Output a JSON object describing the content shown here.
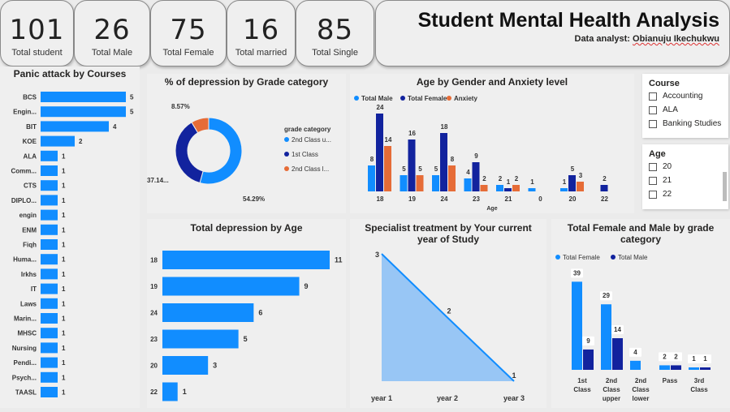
{
  "kpis": [
    {
      "value": "101",
      "label": "Total student"
    },
    {
      "value": "26",
      "label": "Total Male"
    },
    {
      "value": "75",
      "label": "Total Female"
    },
    {
      "value": "16",
      "label": "Total married"
    },
    {
      "value": "85",
      "label": "Total Single"
    }
  ],
  "header": {
    "title": "Student Mental Health Analysis",
    "subtitle_prefix": "Data analyst: ",
    "analyst_name": "Obianuju Ikechukwu"
  },
  "slicers": {
    "course": {
      "title": "Course",
      "items": [
        "Accounting",
        "ALA",
        "Banking Studies"
      ]
    },
    "age": {
      "title": "Age",
      "items": [
        "20",
        "21",
        "22"
      ]
    }
  },
  "colors": {
    "blue": "#118dff",
    "navy": "#12239e",
    "orange": "#e66c37",
    "light_blue": "#98c6f5"
  },
  "chart_data": [
    {
      "id": "panic",
      "type": "bar",
      "orientation": "horizontal",
      "title": "Panic attack by Courses",
      "categories": [
        "BCS",
        "Engin...",
        "BIT",
        "KOE",
        "ALA",
        "Comm...",
        "CTS",
        "DIPLO...",
        "engin",
        "ENM",
        "Fiqh",
        "Huma...",
        "Irkhs",
        "IT",
        "Laws",
        "Marin...",
        "MHSC",
        "Nursing",
        "Pendi...",
        "Psych...",
        "TAASL"
      ],
      "values": [
        5,
        5,
        4,
        2,
        1,
        1,
        1,
        1,
        1,
        1,
        1,
        1,
        1,
        1,
        1,
        1,
        1,
        1,
        1,
        1,
        1
      ],
      "xlim": [
        0,
        5
      ]
    },
    {
      "id": "donut",
      "type": "pie",
      "title": "% of depression by Grade category",
      "legend_title": "grade category",
      "legend": [
        "2nd Class u...",
        "1st Class",
        "2nd Class l..."
      ],
      "values": [
        54.29,
        37.14,
        8.57
      ],
      "labels": [
        "54.29%",
        "37.14...",
        "8.57%"
      ]
    },
    {
      "id": "ageGender",
      "type": "bar",
      "title": "Age by Gender and Anxiety level",
      "xlabel": "Age",
      "categories": [
        "18",
        "19",
        "24",
        "23",
        "21",
        "0",
        "20",
        "22"
      ],
      "series": [
        {
          "name": "Total Male",
          "values": [
            8,
            5,
            5,
            4,
            2,
            1,
            1,
            null
          ]
        },
        {
          "name": "Total Female",
          "values": [
            24,
            16,
            18,
            9,
            1,
            null,
            5,
            2
          ]
        },
        {
          "name": "Anxiety",
          "values": [
            14,
            5,
            8,
            2,
            2,
            null,
            3,
            null
          ]
        }
      ],
      "ylim": [
        0,
        26
      ]
    },
    {
      "id": "depAge",
      "type": "bar",
      "orientation": "horizontal",
      "title": "Total depression by Age",
      "categories": [
        "18",
        "19",
        "24",
        "23",
        "20",
        "22"
      ],
      "values": [
        11,
        9,
        6,
        5,
        3,
        1
      ],
      "xlim": [
        0,
        11
      ]
    },
    {
      "id": "specialist",
      "type": "area",
      "title": "Specialist treatment by Your current year of Study",
      "categories": [
        "year 1",
        "year 2",
        "year 3"
      ],
      "values": [
        3,
        2,
        1
      ],
      "ylim": [
        1,
        3
      ]
    },
    {
      "id": "grade",
      "type": "bar",
      "title": "Total Female and Male by grade category",
      "categories": [
        "1st Class",
        "2nd Class upper",
        "2nd Class lower",
        "Pass",
        "3rd Class"
      ],
      "category_lines": [
        [
          "1st",
          "Class"
        ],
        [
          "2nd",
          "Class",
          "upper"
        ],
        [
          "2nd",
          "Class",
          "lower"
        ],
        [
          "Pass"
        ],
        [
          "3rd",
          "Class"
        ]
      ],
      "series": [
        {
          "name": "Total Female",
          "values": [
            39,
            29,
            4,
            2,
            1
          ]
        },
        {
          "name": "Total Male",
          "values": [
            9,
            14,
            null,
            2,
            1
          ]
        }
      ],
      "ylim": [
        0,
        42
      ]
    }
  ]
}
